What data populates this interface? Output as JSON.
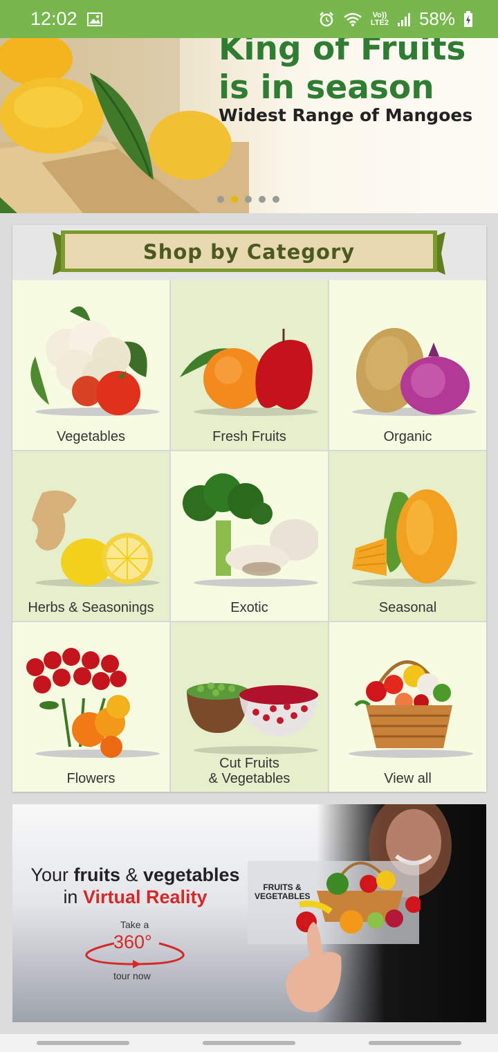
{
  "status_bar": {
    "time": "12:02",
    "lte_line1": "Vo))",
    "lte_line2": "LTE2",
    "battery": "58%",
    "icons": [
      "image-icon",
      "alarm-icon",
      "wifi-icon",
      "signal-icon",
      "battery-icon"
    ]
  },
  "hero": {
    "title_line1": "King of Fruits",
    "title_line2": "is in season",
    "subtitle": "Widest Range of Mangoes",
    "dot_count": 5,
    "active_dot": 1
  },
  "category": {
    "header": "Shop by Category",
    "items": [
      {
        "label": "Vegetables"
      },
      {
        "label": "Fresh Fruits"
      },
      {
        "label": "Organic"
      },
      {
        "label": "Herbs & Seasonings"
      },
      {
        "label": "Exotic"
      },
      {
        "label": "Seasonal"
      },
      {
        "label": "Flowers"
      },
      {
        "label": "Cut Fruits\n& Vegetables"
      },
      {
        "label": "View all"
      }
    ]
  },
  "vr_banner": {
    "line1_prefix": "Your ",
    "line1_bold1": "fruits",
    "line1_mid": " & ",
    "line1_bold2": "vegetables",
    "line2_prefix": "in ",
    "line2_red": "Virtual Reality",
    "take": "Take a",
    "degrees": "360°",
    "tour": "tour now",
    "box_label": "FRUITS & VEGETABLES"
  },
  "colors": {
    "status_bar": "#78b74e",
    "hero_title": "#2e7d32",
    "ribbon_fill": "#e9d9b0",
    "ribbon_border": "#7c9a2e",
    "active_dot": "#e6b800",
    "vr_red": "#d62828"
  }
}
